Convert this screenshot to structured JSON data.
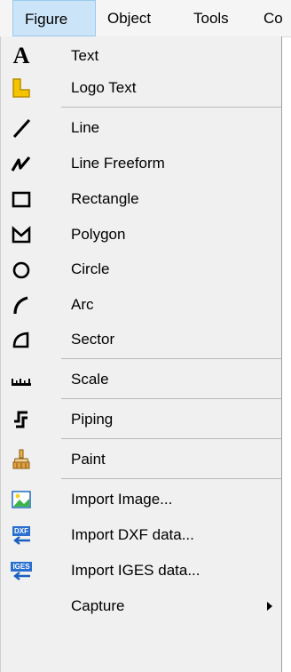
{
  "menubar": {
    "items": [
      "Figure",
      "Object",
      "Tools",
      "Co"
    ]
  },
  "menu": {
    "items": [
      {
        "label": "Text",
        "icon": "text-A-icon"
      },
      {
        "label": "Logo Text",
        "icon": "logo-text-icon"
      },
      {
        "label": "Line",
        "icon": "line-icon"
      },
      {
        "label": "Line Freeform",
        "icon": "line-freeform-icon"
      },
      {
        "label": "Rectangle",
        "icon": "rectangle-icon"
      },
      {
        "label": "Polygon",
        "icon": "polygon-icon"
      },
      {
        "label": "Circle",
        "icon": "circle-icon"
      },
      {
        "label": "Arc",
        "icon": "arc-icon"
      },
      {
        "label": "Sector",
        "icon": "sector-icon"
      },
      {
        "label": "Scale",
        "icon": "scale-ruler-icon"
      },
      {
        "label": "Piping",
        "icon": "piping-icon"
      },
      {
        "label": "Paint",
        "icon": "paint-brush-icon"
      },
      {
        "label": "Import Image...",
        "icon": "import-image-icon"
      },
      {
        "label": "Import DXF data...",
        "icon": "import-dxf-icon"
      },
      {
        "label": "Import IGES data...",
        "icon": "import-iges-icon"
      },
      {
        "label": "Capture",
        "icon": "capture-icon",
        "submenu": true
      }
    ]
  },
  "icon_labels": {
    "text": "A",
    "dxf": "DXF",
    "iges": "IGES"
  },
  "colors": {
    "active_menu_bg": "#cce4f7",
    "active_menu_border": "#99c9ef",
    "menu_bg": "#f0f0f0",
    "logo_yellow": "#f5c400"
  }
}
